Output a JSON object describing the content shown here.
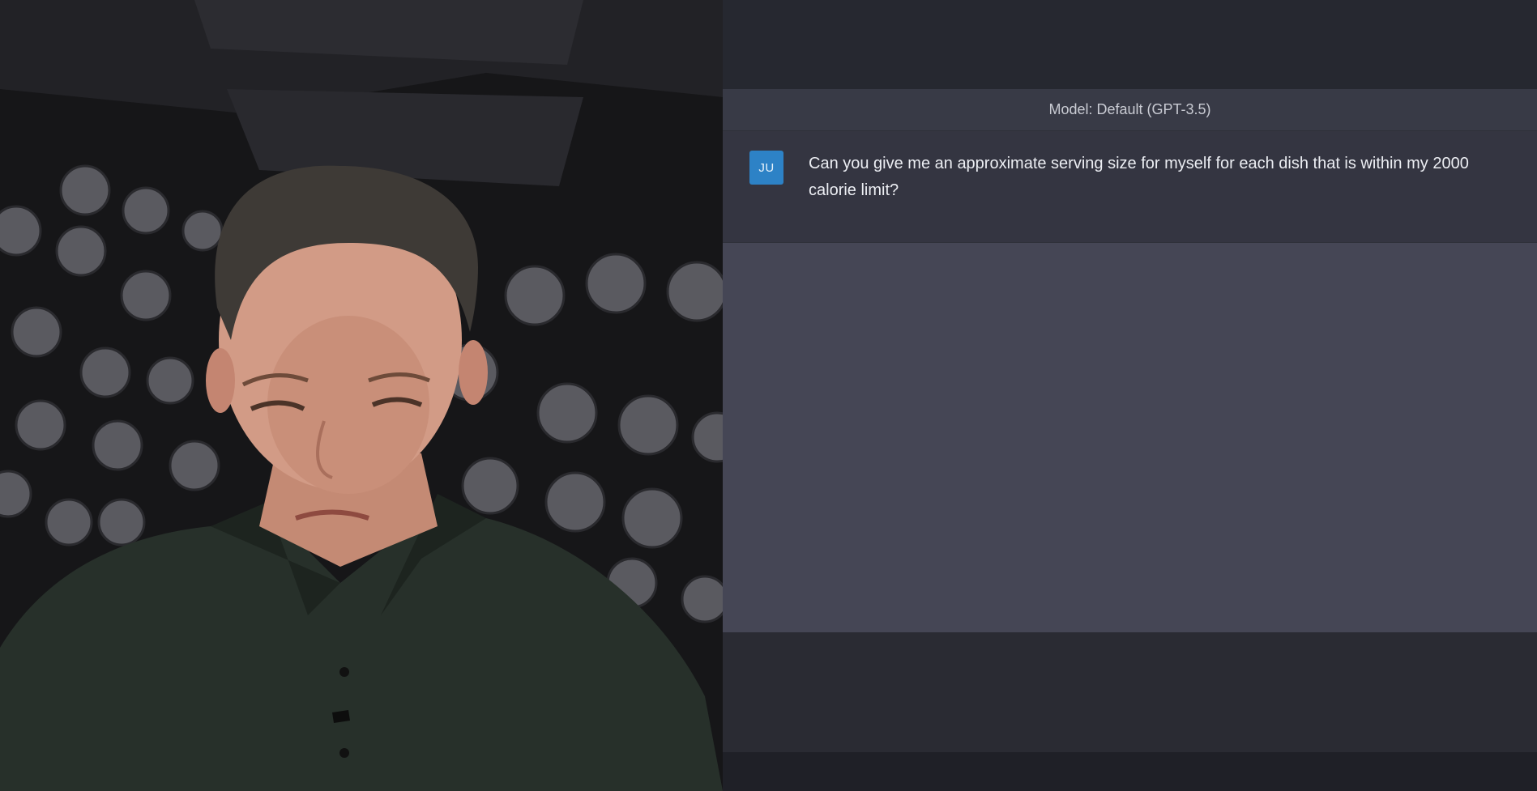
{
  "chat": {
    "model_label": "Model: Default (GPT-3.5)",
    "user_message": {
      "avatar_initials": "JU",
      "text": "Can you give me an approximate serving size for myself for each dish that is within my 2000 calorie limit?"
    }
  },
  "colors": {
    "avatar_bg": "#2d82c6",
    "chat_bg": "#343541",
    "response_bg": "#454655",
    "model_bar_bg": "#383a46"
  }
}
